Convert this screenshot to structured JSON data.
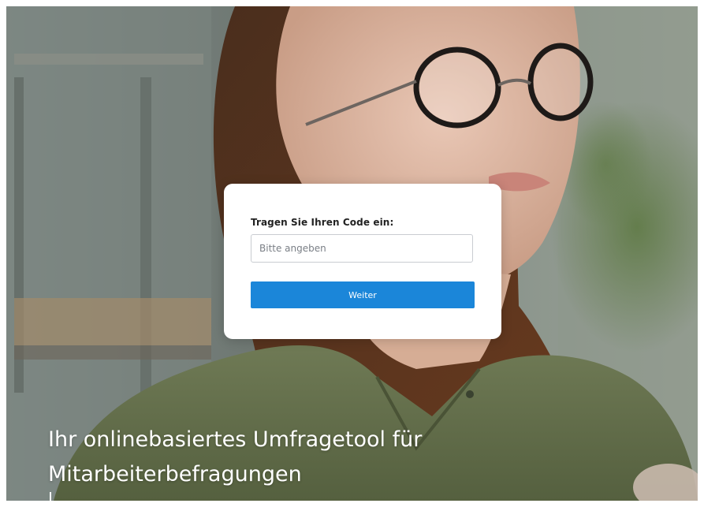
{
  "form": {
    "label": "Tragen Sie Ihren Code ein:",
    "input_placeholder": "Bitte angeben",
    "input_value": "",
    "submit_label": "Weiter"
  },
  "hero": {
    "tagline_line1": "Ihr onlinebasiertes Umfragetool für",
    "tagline_line2": "Mitarbeiterbefragungen"
  },
  "colors": {
    "button": "#1b86d9",
    "card": "#ffffff",
    "tagline": "#ffffff"
  }
}
